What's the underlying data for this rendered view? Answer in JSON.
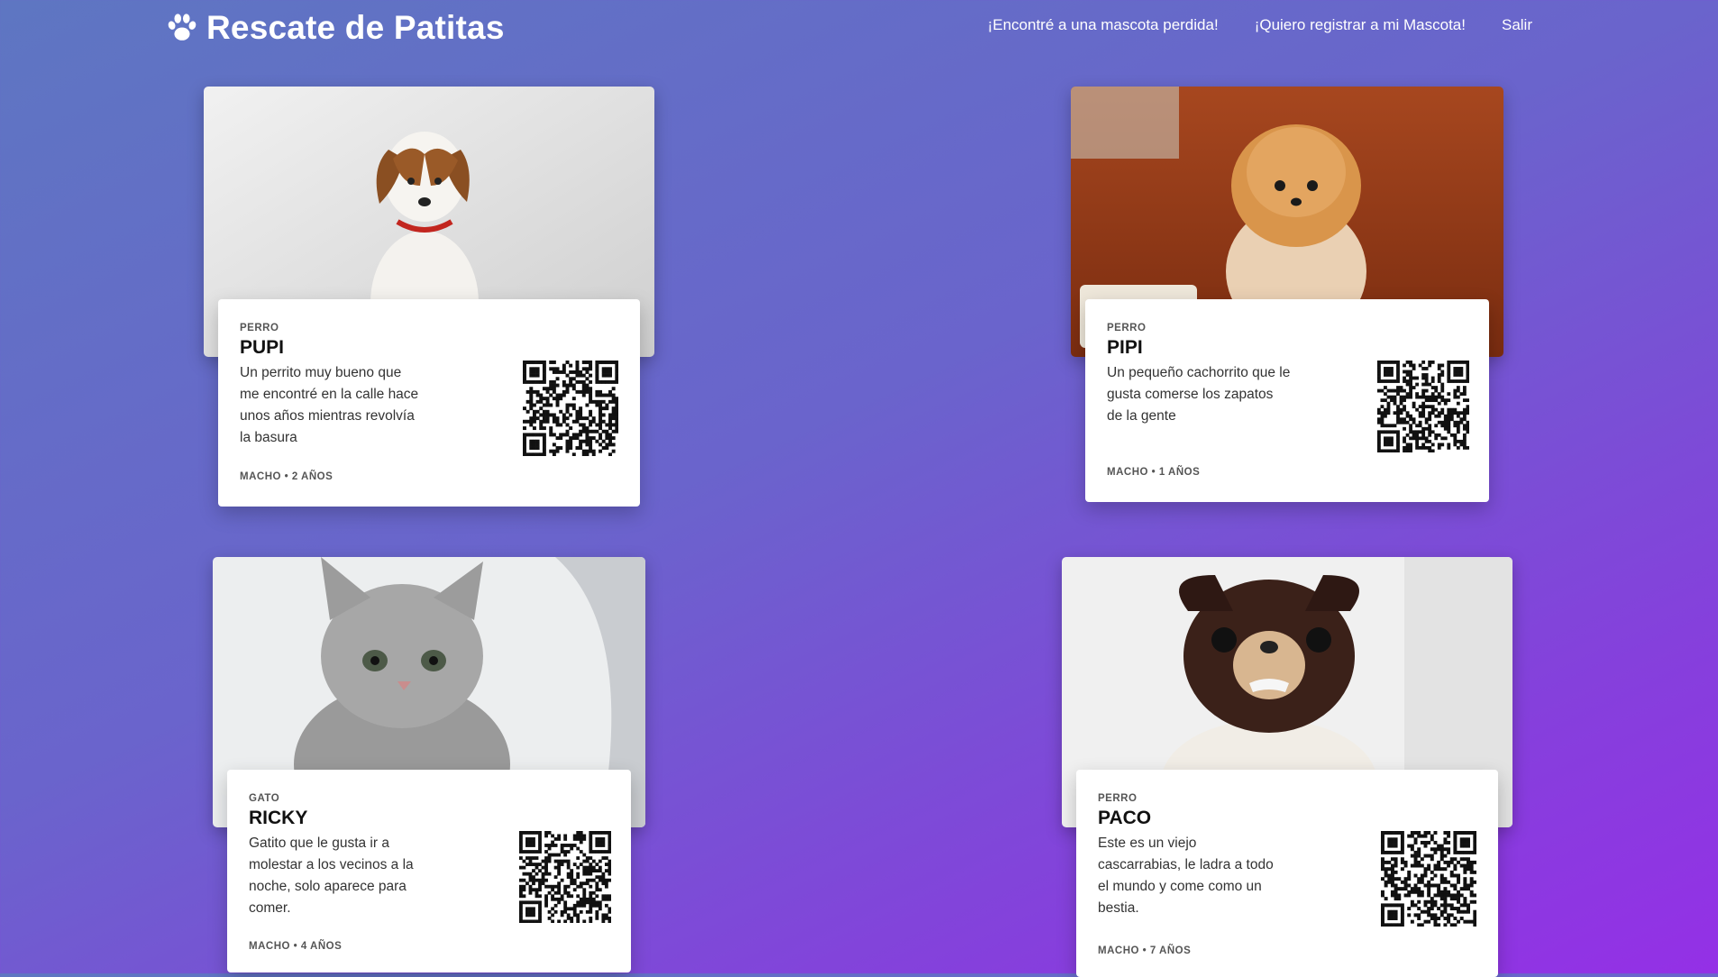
{
  "brand": {
    "title": "Rescate de Patitas",
    "logo_icon": "paw-icon"
  },
  "nav": {
    "found_pet": "¡Encontré a una mascota perdida!",
    "register_pet": "¡Quiero registrar a mi Mascota!",
    "logout": "Salir"
  },
  "pets": [
    {
      "species": "PERRO",
      "name": "PUPI",
      "description": "Un perrito muy bueno que me encontré en la calle hace unos años mientras revolvía la basura",
      "meta": "MACHO • 2 AÑOS"
    },
    {
      "species": "PERRO",
      "name": "PIPI",
      "description": "Un pequeño cachorrito que le gusta comerse los zapatos de la gente",
      "meta": "MACHO • 1 AÑOS"
    },
    {
      "species": "GATO",
      "name": "RICKY",
      "description": "Gatito que le gusta ir a molestar a los vecinos a la noche, solo aparece para comer.",
      "meta": "MACHO • 4 AÑOS"
    },
    {
      "species": "PERRO",
      "name": "PACO",
      "description": "Este es un viejo cascarrabias, le ladra a todo el mundo y come como un bestia.",
      "meta": "MACHO • 7 AÑOS"
    }
  ]
}
